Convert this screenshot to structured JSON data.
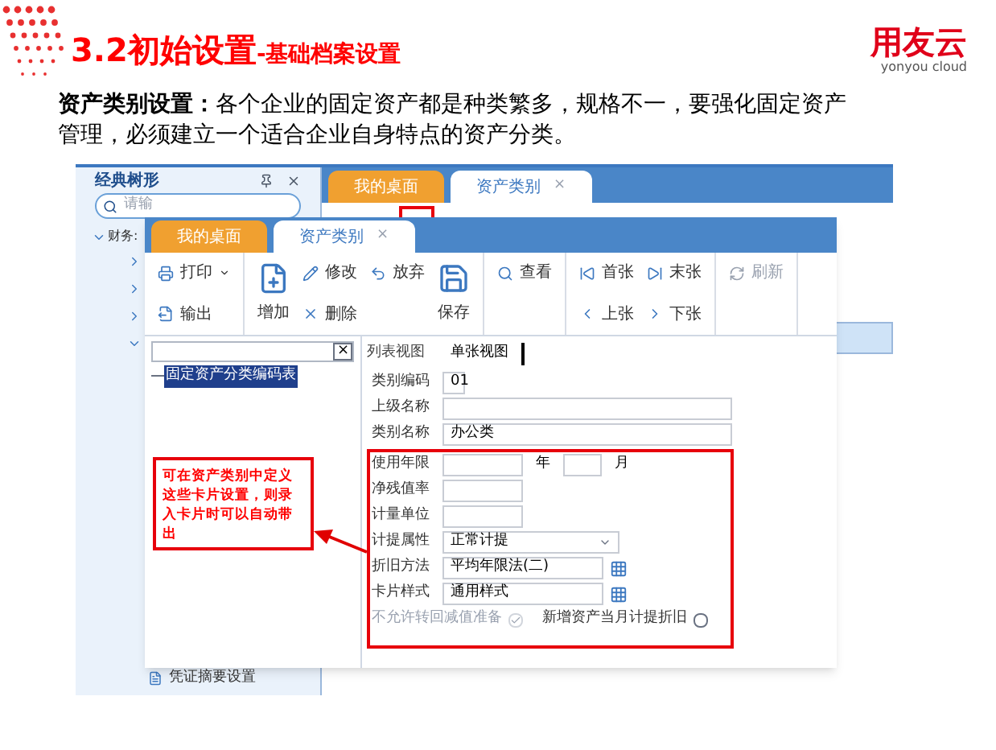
{
  "slide": {
    "title": "3.2初始设置",
    "subtitle": "-基础档案设置",
    "logo": {
      "name": "用友云",
      "tagline": "yonyou cloud"
    },
    "intro": "**资产类别设置：**各个企业的固定资产都是种类繁多，规格不一，要强化固定资产管理，必须建立一个适合企业自身特点的资产分类。"
  },
  "back_window": {
    "panel_title": "经典树形",
    "search": {
      "placeholder": "请输"
    },
    "tree": [
      {
        "label": "财务:",
        "expanded": true,
        "children": [
          {
            "expanded": false
          },
          {
            "expanded": false
          },
          {
            "expanded": false
          },
          {
            "expanded": true
          }
        ]
      }
    ],
    "footer_item": "凭证摘要设置",
    "tabs": [
      {
        "label": "我的桌面",
        "selected": false
      },
      {
        "label": "资产类别",
        "selected": true,
        "close": "×"
      }
    ]
  },
  "front_window": {
    "tabs": [
      {
        "label": "我的桌面",
        "selected": false
      },
      {
        "label": "资产类别",
        "selected": true,
        "close": "×"
      }
    ],
    "toolbar": [
      {
        "items": [
          {
            "label": "打印",
            "kind": "small",
            "dropdown": true,
            "disabled": false
          },
          {
            "label": "输出",
            "kind": "small",
            "dropdown": false,
            "disabled": false
          }
        ]
      },
      {
        "items": [
          {
            "label": "增加",
            "kind": "large",
            "dropdown": false,
            "disabled": false
          },
          {
            "label": "修改",
            "kind": "small",
            "dropdown": false,
            "disabled": false
          },
          {
            "label": "删除",
            "kind": "small",
            "dropdown": false,
            "disabled": false
          },
          {
            "label": "放弃",
            "kind": "small",
            "dropdown": false,
            "disabled": false
          },
          {
            "label": "保存",
            "kind": "large",
            "dropdown": false,
            "disabled": false
          }
        ]
      },
      {
        "items": [
          {
            "label": "查看",
            "kind": "small",
            "dropdown": false,
            "disabled": false
          }
        ]
      },
      {
        "items": [
          {
            "label": "首张",
            "kind": "small",
            "dropdown": false,
            "disabled": false
          },
          {
            "label": "上张",
            "kind": "small",
            "dropdown": false,
            "disabled": false
          },
          {
            "label": "末张",
            "kind": "small",
            "dropdown": false,
            "disabled": false
          },
          {
            "label": "下张",
            "kind": "small",
            "dropdown": false,
            "disabled": false
          }
        ]
      },
      {
        "items": [
          {
            "label": "刷新",
            "kind": "small",
            "dropdown": false,
            "disabled": true
          }
        ]
      }
    ],
    "tree_search": {
      "clear": "×"
    },
    "tree": [
      {
        "label": "固定资产分类编码表",
        "selected": true
      }
    ],
    "view_tabs": [
      {
        "label": "列表视图",
        "selected": false
      },
      {
        "label": "单张视图",
        "selected": true
      }
    ],
    "fields": [
      {
        "label": "类别编码",
        "kind": "short",
        "value": "01"
      },
      {
        "label": "上级名称",
        "kind": "text"
      },
      {
        "label": "类别名称",
        "kind": "text",
        "value": "办公类"
      }
    ],
    "highlighted_fields": [
      {
        "label": "使用年限",
        "kind": "year_month",
        "unit_year": "年",
        "unit_month": "月"
      },
      {
        "label": "净残值率",
        "kind": "medium"
      },
      {
        "label": "计量单位",
        "kind": "medium"
      },
      {
        "label": "计提属性",
        "kind": "select",
        "value": "正常计提"
      },
      {
        "label": "折旧方法",
        "kind": "picker",
        "value": "平均年限法(二)"
      },
      {
        "label": "卡片样式",
        "kind": "picker",
        "value": "通用样式"
      }
    ],
    "checkboxes": [
      {
        "label": "不允许转回减值准备",
        "checked": true,
        "disabled": true
      },
      {
        "label": "新增资产当月计提折旧",
        "checked": false,
        "disabled": false
      }
    ]
  },
  "callout": "可在资产类别中定义这些卡片设置，则录入卡片时可以自动带出"
}
